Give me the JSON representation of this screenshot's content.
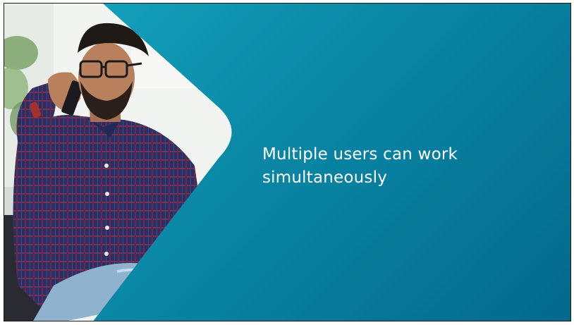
{
  "slide": {
    "title": "Multiple users can work simultaneously"
  },
  "photo": {
    "subject": "man-on-phone",
    "colors": {
      "shirt": "#2b2f63",
      "skin": "#b8805d",
      "hair": "#1e1914",
      "jeans": "#8fb3cf",
      "background": "#f2f4f1",
      "plant": "#7ba36a"
    }
  },
  "theme": {
    "accent_start": "#16a7c0",
    "accent_end": "#03698d",
    "text": "#ffffff"
  }
}
